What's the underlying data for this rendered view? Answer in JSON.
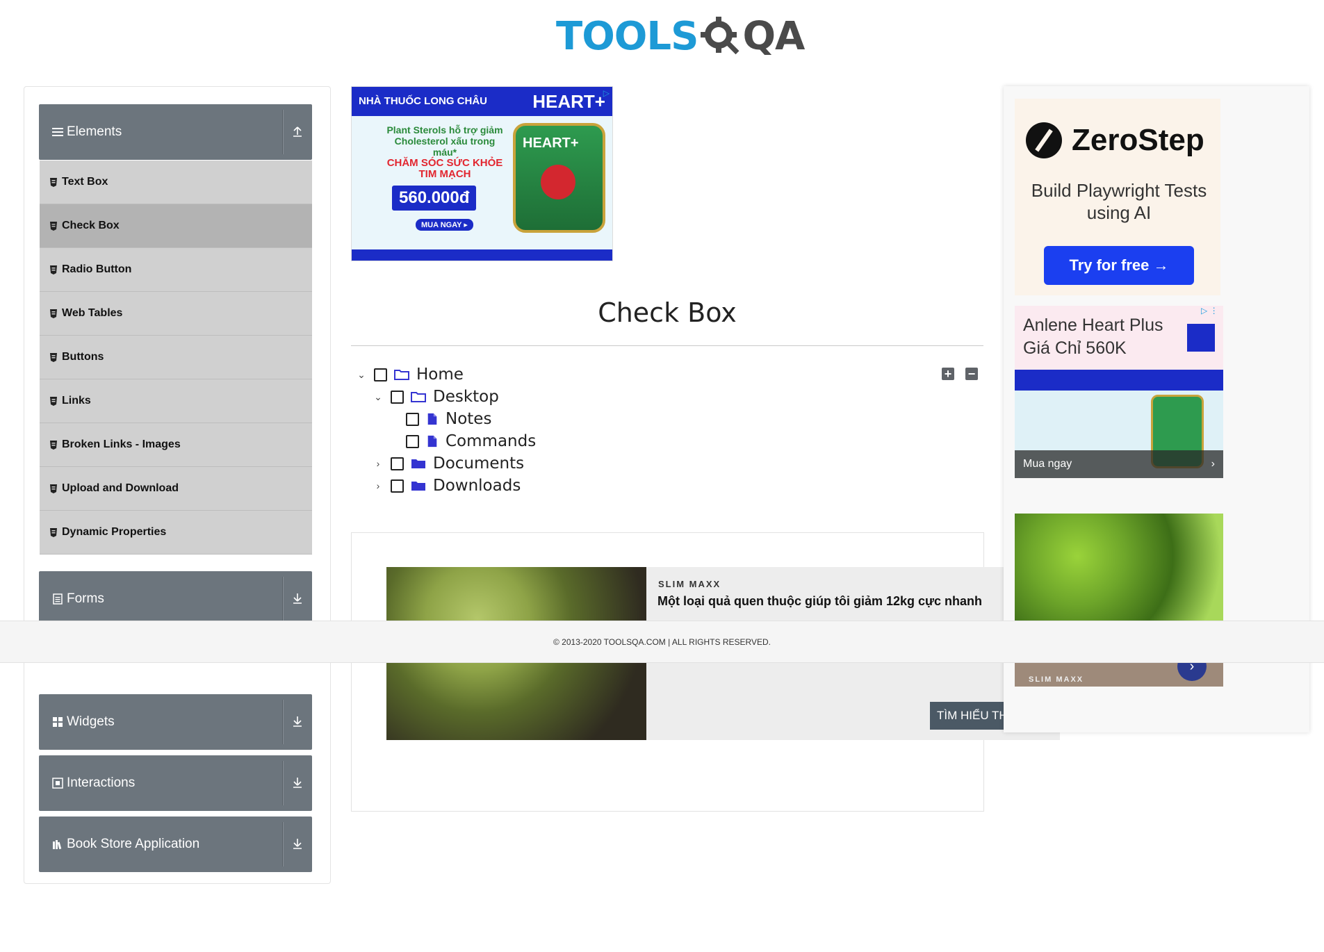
{
  "header": {
    "logo_text_left": "TOOLS",
    "logo_text_right": "QA"
  },
  "sidebar": {
    "groups": [
      {
        "label": "Elements",
        "icon": "menu-icon",
        "arrow": "collapse-up-icon"
      },
      {
        "label": "Forms",
        "icon": "form-icon",
        "arrow": "expand-down-icon"
      },
      {
        "label": "Widgets",
        "icon": "widgets-icon",
        "arrow": "expand-down-icon"
      },
      {
        "label": "Interactions",
        "icon": "interactions-icon",
        "arrow": "expand-down-icon"
      },
      {
        "label": "Book Store Application",
        "icon": "book-store-icon",
        "arrow": "expand-down-icon"
      }
    ],
    "items": [
      {
        "label": "Text Box"
      },
      {
        "label": "Check Box",
        "active": true
      },
      {
        "label": "Radio Button"
      },
      {
        "label": "Web Tables"
      },
      {
        "label": "Buttons"
      },
      {
        "label": "Links"
      },
      {
        "label": "Broken Links - Images"
      },
      {
        "label": "Upload and Download"
      },
      {
        "label": "Dynamic Properties"
      }
    ]
  },
  "top_ad": {
    "pharmacy": "NHÀ THUỐC LONG CHÂU",
    "brand": "HEART+",
    "line1": "Plant Sterols hỗ trợ giảm Cholesterol xấu trong máu*",
    "line2": "CHĂM SÓC SỨC KHỎE TIM MẠCH",
    "price": "560.000đ",
    "buy": "MUA NGAY ▸"
  },
  "main": {
    "title": "Check Box",
    "tree": [
      {
        "label": "Home",
        "level": 0,
        "expanded": true,
        "type": "folder"
      },
      {
        "label": "Desktop",
        "level": 1,
        "expanded": true,
        "type": "folder"
      },
      {
        "label": "Notes",
        "level": 2,
        "type": "file"
      },
      {
        "label": "Commands",
        "level": 2,
        "type": "file"
      },
      {
        "label": "Documents",
        "level": 1,
        "expanded": false,
        "type": "folder"
      },
      {
        "label": "Downloads",
        "level": 1,
        "expanded": false,
        "type": "folder"
      }
    ],
    "expand_all": "+",
    "collapse_all": "−"
  },
  "content_ad": {
    "brand": "SLIM MAXX",
    "headline": "Một loại quả quen thuộc giúp tôi giảm 12kg cực nhanh",
    "cta": "TÌM HIỂU TH"
  },
  "footer": {
    "text": "© 2013-2020 TOOLSQA.COM | ALL RIGHTS RESERVED."
  },
  "right_ad": {
    "zerostep_name": "ZeroStep",
    "zerostep_sub": "Build Playwright Tests using AI",
    "zerostep_cta": "Try for free →",
    "anlene_title": "Anlene Heart Plus Giá Chỉ 560K",
    "anlene_cta": "Mua ngay",
    "slim_brand": "SLIM MAXX"
  },
  "colors": {
    "sidebar_header": "#6c757d",
    "sidebar_item": "#d0d0d0",
    "tree_icon": "#3434d1",
    "logo_blue": "#1d9ad6"
  }
}
